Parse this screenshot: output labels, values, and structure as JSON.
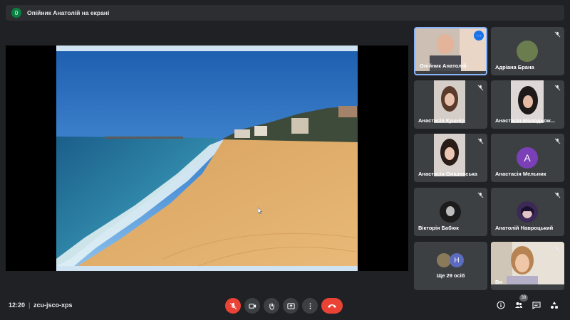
{
  "presentation_banner": {
    "badge": "0",
    "text": "Опійник Анатолій на екрані"
  },
  "participants": [
    {
      "name": "Опійник Анатолій",
      "state": "presenting"
    },
    {
      "name": "Адріана Брана",
      "state": "muted"
    },
    {
      "name": "Анастасія Кушнір",
      "state": "muted"
    },
    {
      "name": "Анастасія Молодьож...",
      "state": "muted"
    },
    {
      "name": "Анастасія Олішевська",
      "state": "muted"
    },
    {
      "name": "Анастасія Мельник",
      "state": "muted",
      "initial": "A"
    },
    {
      "name": "Вікторія Бабюк",
      "state": "muted"
    },
    {
      "name": "Анатолій Навроцький",
      "state": "muted"
    },
    {
      "name": "Ще 29 осіб",
      "initial": "H"
    },
    {
      "name": "Ви",
      "state": "muted"
    }
  ],
  "bottom_bar": {
    "time": "12:20",
    "separator": "|",
    "meeting_code": "zcu-jsco-xps",
    "participant_count": "39"
  },
  "colors": {
    "background": "#202124",
    "tile": "#3c4043",
    "active_border": "#8ab4f8",
    "danger": "#ea4335",
    "avatar_purple": "#7b3fb8"
  }
}
